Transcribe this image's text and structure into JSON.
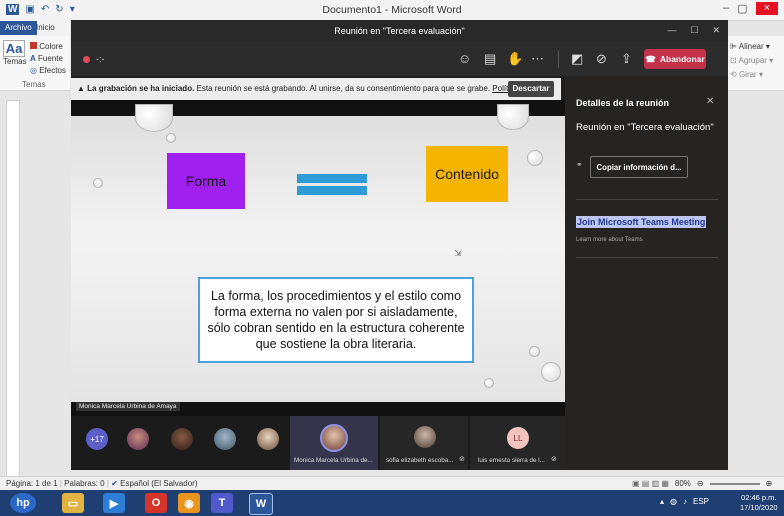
{
  "word": {
    "title": "Documento1 - Microsoft Word",
    "tab_archivo": "Archivo",
    "tab_inicio": "Inicio",
    "ribbon_left": [
      "Colore",
      "Fuente",
      "Efectos"
    ],
    "temas": "Temas",
    "temas_group": "Temas",
    "ribbon_right": [
      "Alinear",
      "Agrupar",
      "Girar"
    ],
    "minimize": "–",
    "maximize": "▢",
    "close": "×"
  },
  "teams": {
    "window_title": "Reunión en \"Tercera evaluación\"",
    "rec_dots": "-:-",
    "leave_label": "Abandonar",
    "banner_bold": "La grabación se ha iniciado.",
    "banner_text": "Esta reunión se está grabando. Al unirse, da su consentimiento para que se grabe.",
    "banner_link": "Política de priv...",
    "discard_label": "Descartar"
  },
  "slide": {
    "forma": "Forma",
    "contenido": "Contenido",
    "quote": "La forma, los procedimientos y el estilo como forma externa no valen por si aisladamente, sólo cobran sentido en la estructura coherente que sostiene la obra literaria."
  },
  "speaker_name": "Monica Marcela Urbina de Amaya",
  "participants": {
    "more_count": "+17",
    "tiles": [
      {
        "name": "Monica Marcela Urbina de..."
      },
      {
        "name": "sofia elizabeth escoba..."
      },
      {
        "name": "luis ernesto sierra de l...",
        "initials": "LL"
      }
    ]
  },
  "panel": {
    "title": "Detalles de la reunión",
    "meeting_name": "Reunión en \"Tercera evaluación\"",
    "copy_label": "Copiar información d...",
    "join_link": "Join Microsoft Teams Meeting",
    "learn_more": "Learn more about Teams"
  },
  "status": {
    "page": "Página: 1 de 1",
    "words": "Palabras: 0",
    "language": "Español (El Salvador)",
    "zoom": "80%"
  },
  "taskbar": {
    "lang": "ESP",
    "time": "02:46 p.m.",
    "date": "17/10/2020"
  },
  "colors": {
    "teams_bg": "#1f1f1f",
    "leave_red": "#c4314b",
    "forma_purple": "#a020f0",
    "contenido_orange": "#f5b400",
    "word_blue": "#2b579a"
  }
}
